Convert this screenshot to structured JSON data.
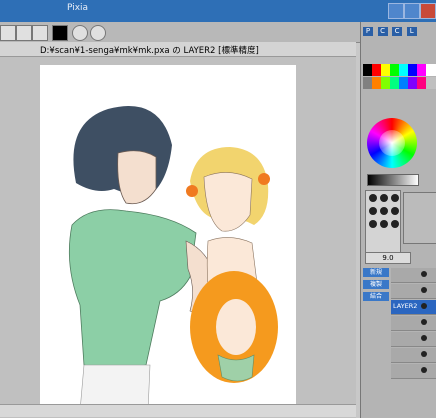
{
  "app": {
    "title": "Pixia"
  },
  "doc": {
    "path": "D:¥scan¥1-senga¥mk¥mk.pxa の LAYER2 [標準精度]"
  },
  "panel": {
    "tabs": [
      "P",
      "C",
      "C",
      "L"
    ],
    "size_label": "9.0",
    "layer_buttons": [
      "新規",
      "複製",
      "結合"
    ],
    "layers": [
      {
        "name": "",
        "selected": false
      },
      {
        "name": "",
        "selected": false
      },
      {
        "name": "LAYER2",
        "selected": true
      },
      {
        "name": "",
        "selected": false
      },
      {
        "name": "",
        "selected": false
      },
      {
        "name": "",
        "selected": false
      },
      {
        "name": "",
        "selected": false
      }
    ]
  },
  "colors": {
    "titlebar": "#2e6fb6",
    "palette": [
      "#000000",
      "#ff0000",
      "#ffff00",
      "#00ff00",
      "#00ffff",
      "#0000ff",
      "#ff00ff",
      "#ffffff",
      "#808080",
      "#ff8000",
      "#80ff00",
      "#00ff80",
      "#0080ff",
      "#8000ff",
      "#ff0080",
      "#c0c0c0"
    ]
  }
}
